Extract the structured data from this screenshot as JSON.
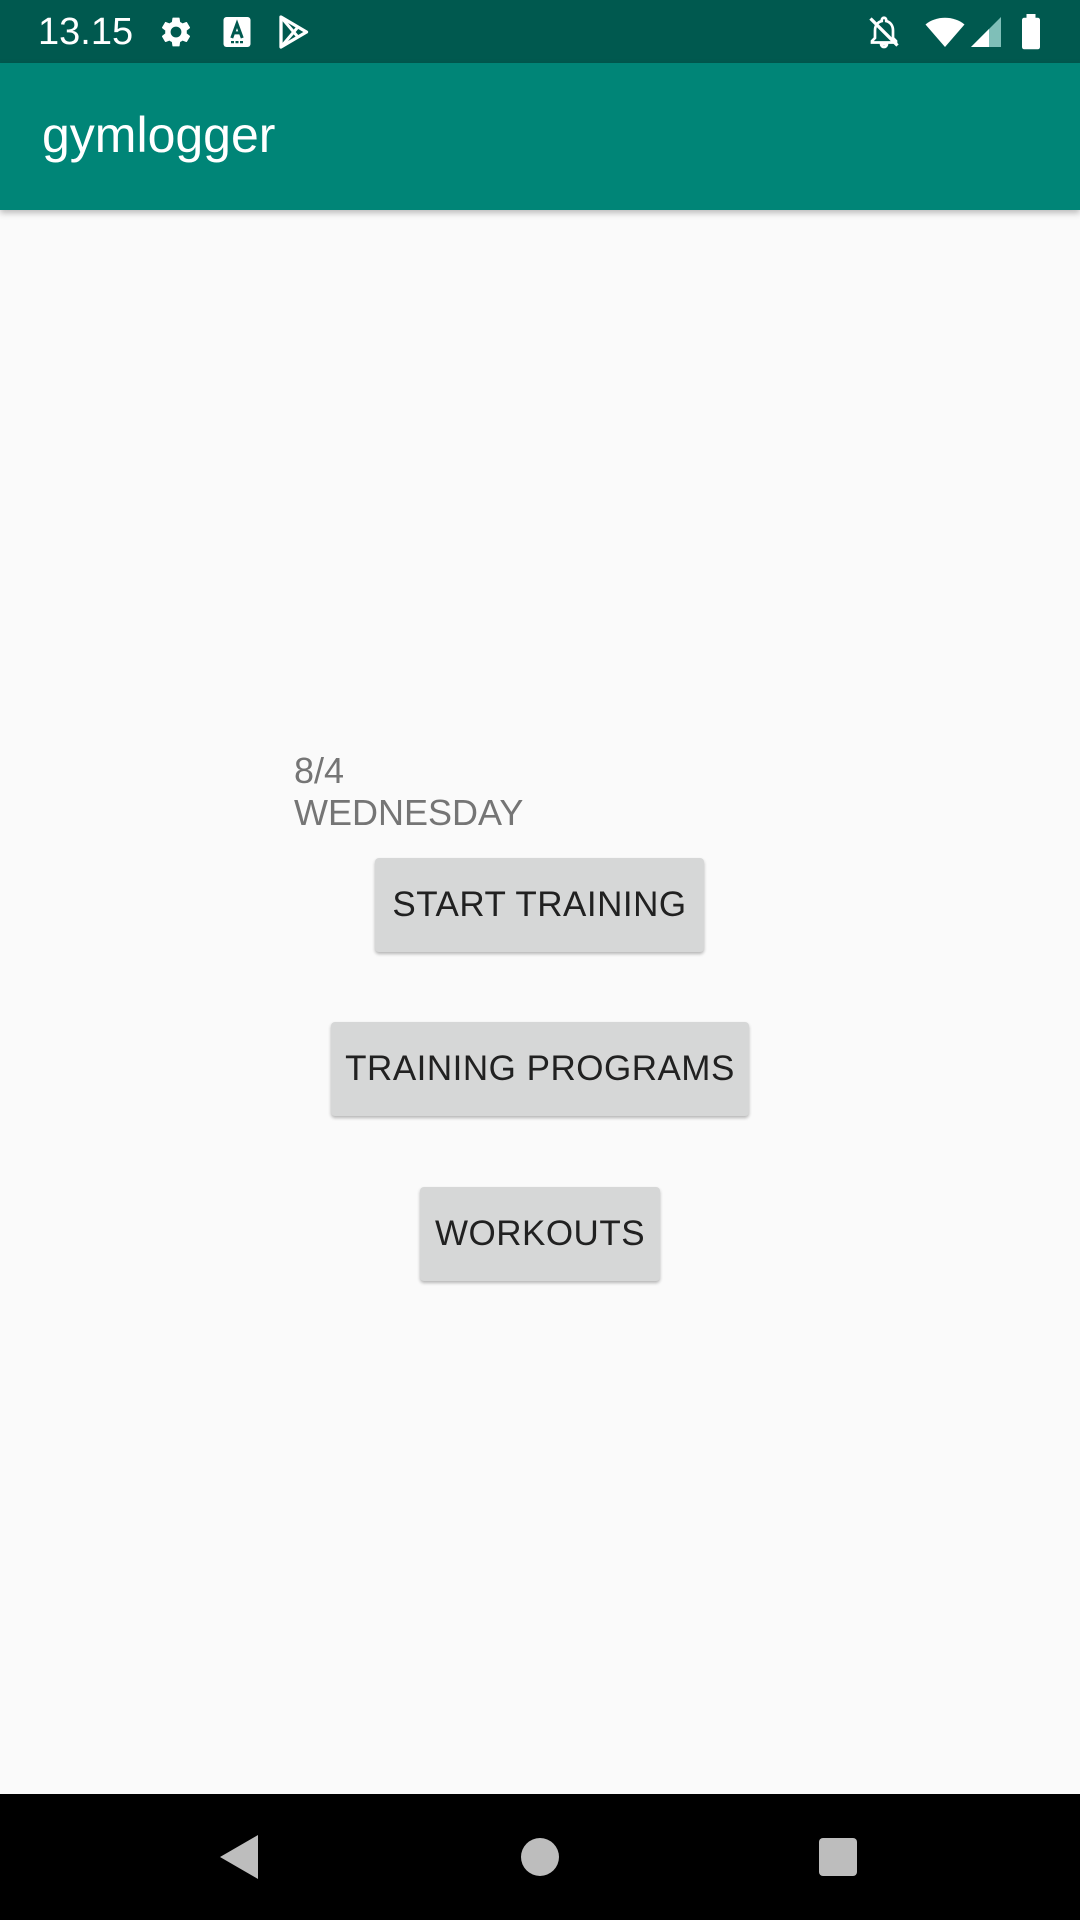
{
  "status_bar": {
    "time": "13.15",
    "icons": [
      "gear-icon",
      "text-a-icon",
      "play-store-icon",
      "notifications-off-icon",
      "wifi-icon",
      "signal-icon",
      "battery-icon"
    ]
  },
  "app_bar": {
    "title": "gymlogger"
  },
  "main": {
    "date": "8/4",
    "weekday": "WEDNESDAY",
    "buttons": {
      "start_training": "START TRAINING",
      "training_programs": "TRAINING PROGRAMS",
      "workouts": "WORKOUTS"
    }
  },
  "nav_bar": {
    "icons": [
      "back-icon",
      "home-icon",
      "recents-icon"
    ]
  },
  "colors": {
    "status_bar": "#00594f",
    "app_bar": "#008577",
    "background": "#fafafa",
    "button": "#d6d7d7",
    "secondary_text": "#757575"
  }
}
